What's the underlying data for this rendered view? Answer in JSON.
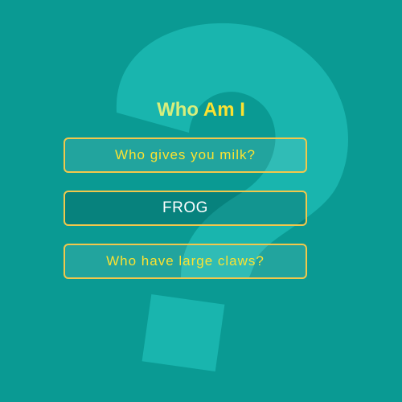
{
  "game": {
    "title_part1": "Who",
    "title_part2": "Am I",
    "options": [
      {
        "label": "Who gives you milk?",
        "selected": false
      },
      {
        "label": "FROG",
        "selected": true
      },
      {
        "label": "Who have large claws?",
        "selected": false
      }
    ]
  },
  "colors": {
    "background": "#0a9a93",
    "question_mark": "#19b5ae",
    "accent_yellow": "#fbe231",
    "border_gold": "#f2c84b"
  },
  "icons": {
    "background_glyph": "question-mark-icon"
  }
}
